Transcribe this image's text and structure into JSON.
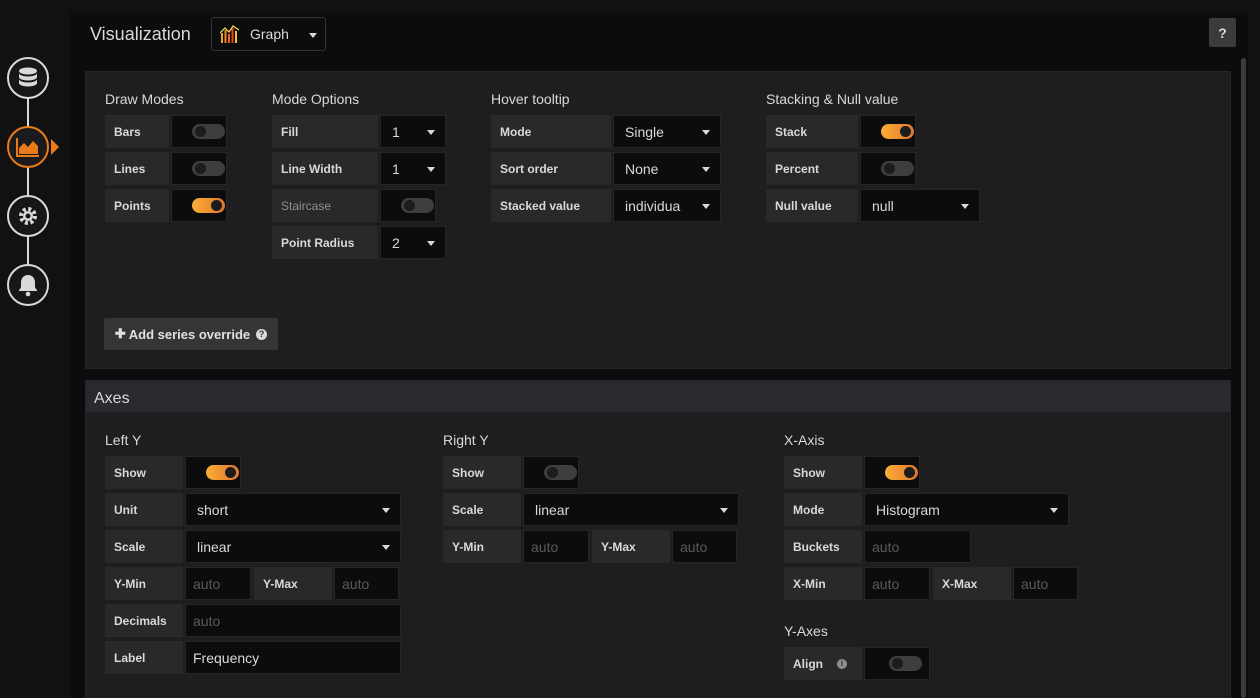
{
  "header": {
    "title": "Visualization",
    "viz_picker": "Graph",
    "help": "?"
  },
  "sidebar": {
    "items": [
      {
        "icon": "database-icon"
      },
      {
        "icon": "chart-area-icon",
        "active": true
      },
      {
        "icon": "gear-icon"
      },
      {
        "icon": "bell-icon"
      }
    ]
  },
  "draw_modes": {
    "title": "Draw Modes",
    "bars": {
      "label": "Bars",
      "on": false
    },
    "lines": {
      "label": "Lines",
      "on": false
    },
    "points": {
      "label": "Points",
      "on": true
    }
  },
  "mode_options": {
    "title": "Mode Options",
    "fill": {
      "label": "Fill",
      "value": "1"
    },
    "line_width": {
      "label": "Line Width",
      "value": "1"
    },
    "staircase": {
      "label": "Staircase",
      "on": false
    },
    "point_radius": {
      "label": "Point Radius",
      "value": "2"
    }
  },
  "hover_tooltip": {
    "title": "Hover tooltip",
    "mode": {
      "label": "Mode",
      "value": "Single"
    },
    "sort_order": {
      "label": "Sort order",
      "value": "None"
    },
    "stacked_value": {
      "label": "Stacked value",
      "value": "individua"
    }
  },
  "stacking": {
    "title": "Stacking & Null value",
    "stack": {
      "label": "Stack",
      "on": true
    },
    "percent": {
      "label": "Percent",
      "on": false
    },
    "null_value": {
      "label": "Null value",
      "value": "null"
    }
  },
  "add_override": {
    "label": "Add series override"
  },
  "axes": {
    "title": "Axes",
    "left_y": {
      "title": "Left Y",
      "show": {
        "label": "Show",
        "on": true
      },
      "unit": {
        "label": "Unit",
        "value": "short"
      },
      "scale": {
        "label": "Scale",
        "value": "linear"
      },
      "ymin": {
        "label": "Y-Min",
        "placeholder": "auto"
      },
      "ymax": {
        "label": "Y-Max",
        "placeholder": "auto"
      },
      "decimals": {
        "label": "Decimals",
        "placeholder": "auto"
      },
      "label": {
        "label": "Label",
        "value": "Frequency"
      }
    },
    "right_y": {
      "title": "Right Y",
      "show": {
        "label": "Show",
        "on": false
      },
      "scale": {
        "label": "Scale",
        "value": "linear"
      },
      "ymin": {
        "label": "Y-Min",
        "placeholder": "auto"
      },
      "ymax": {
        "label": "Y-Max",
        "placeholder": "auto"
      }
    },
    "x_axis": {
      "title": "X-Axis",
      "show": {
        "label": "Show",
        "on": true
      },
      "mode": {
        "label": "Mode",
        "value": "Histogram"
      },
      "buckets": {
        "label": "Buckets",
        "placeholder": "auto"
      },
      "xmin": {
        "label": "X-Min",
        "placeholder": "auto"
      },
      "xmax": {
        "label": "X-Max",
        "placeholder": "auto"
      }
    },
    "y_axes": {
      "title": "Y-Axes",
      "align": {
        "label": "Align",
        "on": false
      }
    }
  },
  "colors": {
    "accent": "#eb7b18",
    "panel": "#1e1e20",
    "background": "#0b0c0e"
  }
}
